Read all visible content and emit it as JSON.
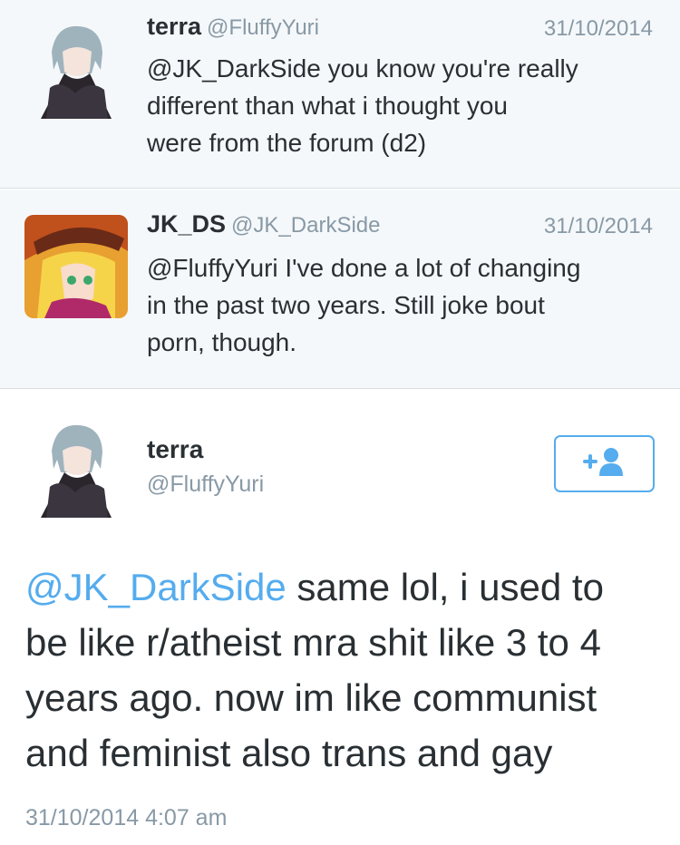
{
  "replies": [
    {
      "name": "terra",
      "handle": "@FluffyYuri",
      "date": "31/10/2014",
      "text_lines": [
        "@JK_DarkSide you know you're really",
        "different than what i thought you",
        "were from the forum (d2)"
      ]
    },
    {
      "name": "JK_DS",
      "handle": "@JK_DarkSide",
      "date": "31/10/2014",
      "text_lines": [
        "@FluffyYuri I've done a lot of changing",
        "in the past two years. Still joke bout",
        "porn, though."
      ]
    }
  ],
  "main": {
    "name": "terra",
    "handle": "@FluffyYuri",
    "mention": "@JK_DarkSide",
    "text_lines": [
      " same lol, i used to",
      "be like r/atheist mra shit like 3 to 4",
      "years ago. now im like communist",
      "and feminist also trans and gay"
    ],
    "timestamp": "31/10/2014 4:07 am"
  },
  "icons": {
    "follow": "add-user-icon"
  },
  "colors": {
    "accent": "#55acee",
    "muted": "#8899a6",
    "thread_bg": "#f5f8fa"
  }
}
